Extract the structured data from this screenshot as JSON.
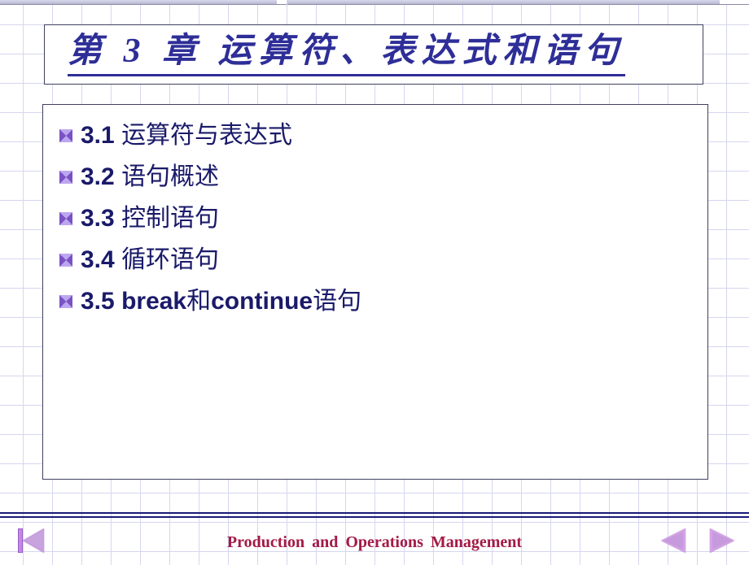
{
  "title": "第 3 章 运算符、表达式和语句",
  "items": [
    {
      "num": "3.1",
      "label": "运算符与表达式"
    },
    {
      "num": "3.2",
      "label": "语句概述"
    },
    {
      "num": "3.3",
      "label": "控制语句"
    },
    {
      "num": "3.4",
      "label": "循环语句"
    },
    {
      "num": "3.5",
      "label_html": "<b>break</b>和<b>continue</b>语句"
    }
  ],
  "footer": "Production  and Operations  Management"
}
